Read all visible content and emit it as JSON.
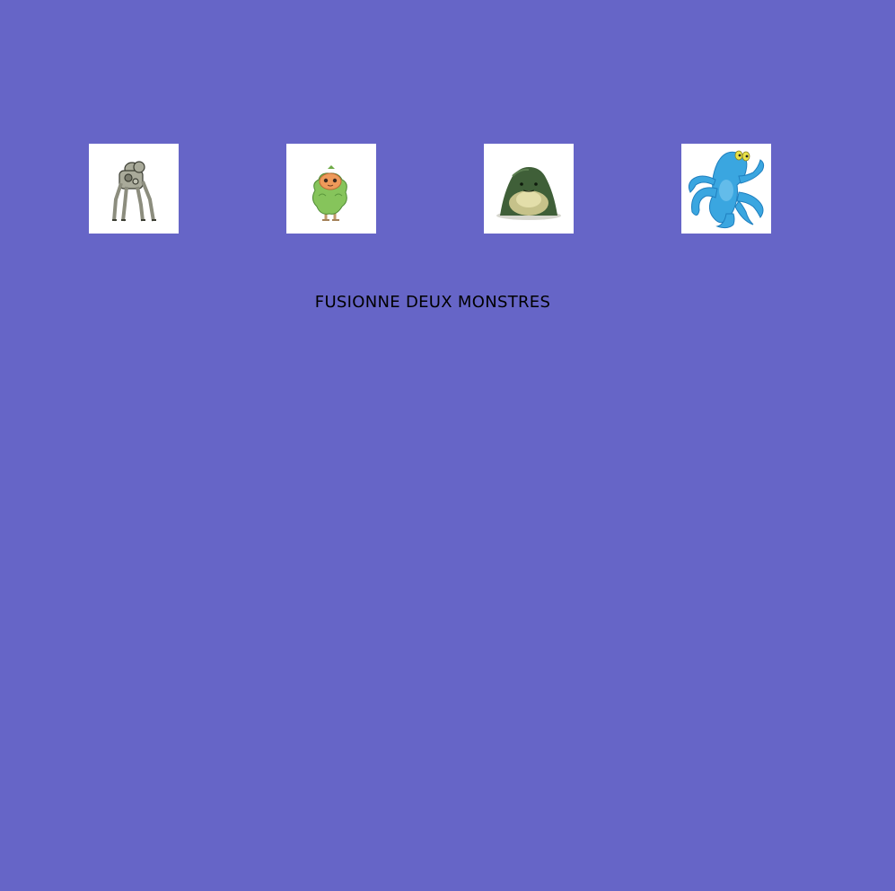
{
  "background_color": "#6665c7",
  "monsters": [
    {
      "name": "gray-spider-robot-monster",
      "icon": "spider-robot-icon"
    },
    {
      "name": "green-leafy-orange-face-monster",
      "icon": "leafy-monster-icon"
    },
    {
      "name": "green-blob-monster",
      "icon": "blob-monster-icon"
    },
    {
      "name": "blue-octopus-monster",
      "icon": "octopus-monster-icon"
    }
  ],
  "action": {
    "label": "FUSIONNE DEUX MONSTRES"
  }
}
